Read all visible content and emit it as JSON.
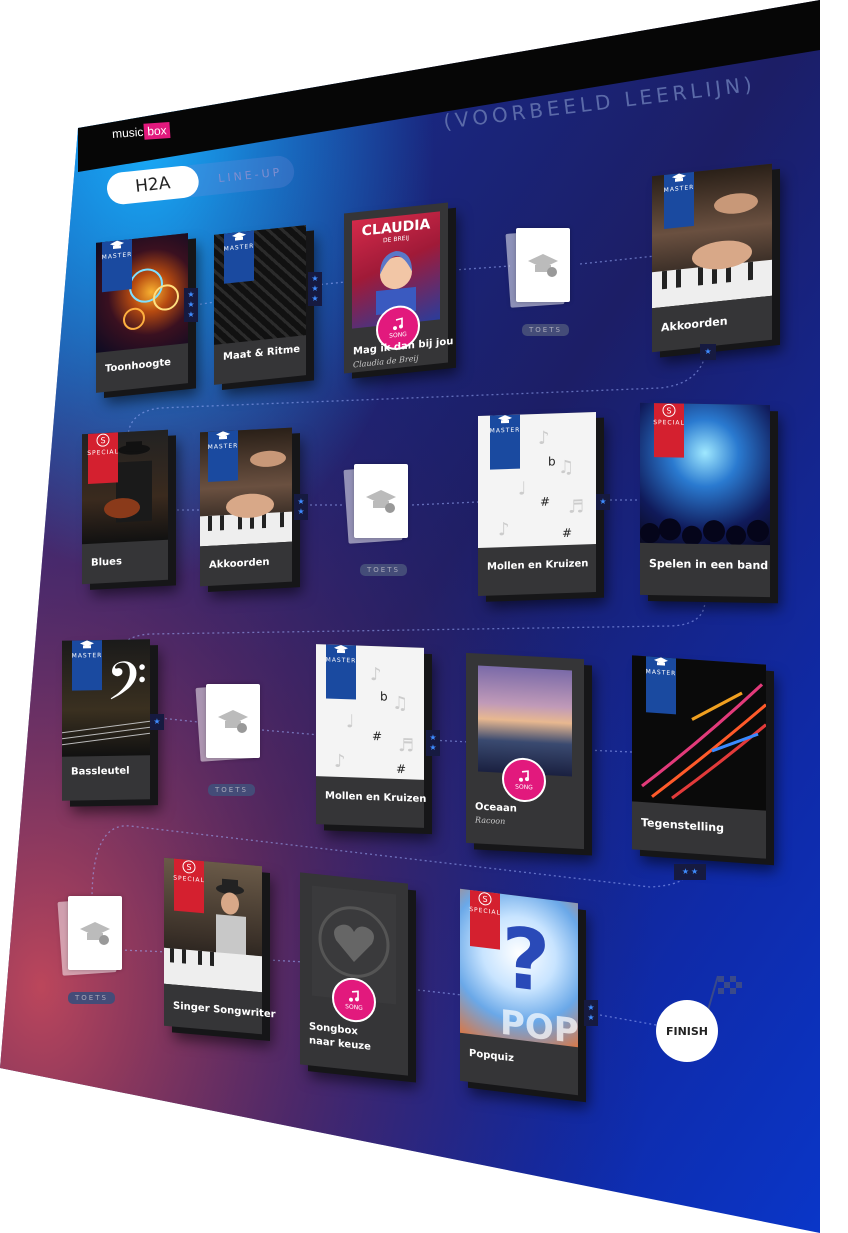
{
  "brand": {
    "name_part1": "music",
    "name_part2": "box"
  },
  "poster_title": "(VOORBEELD LEERLIJN)",
  "tabs": {
    "active": "H2A",
    "inactive": "LINE-UP"
  },
  "toets_label": "TOETS",
  "finish_label": "FINISH",
  "ribbons": {
    "master": "MASTER",
    "special": "SPECIAL"
  },
  "song_badge": "SONG",
  "colors": {
    "song_pink": "#e2197d",
    "master_blue": "#1a4aa0",
    "special_red": "#d4202f",
    "star_blue": "#3f8cff"
  },
  "rows": [
    {
      "cards": [
        {
          "title": "Toonhoogte",
          "ribbon": "master"
        },
        {
          "title": "Maat & Ritme",
          "ribbon": "master"
        },
        {
          "title": "Mag ik dan bij jou",
          "subtitle": "Claudia de Breij",
          "type": "song",
          "cover_line1": "CLAUDIA",
          "cover_line2": "DE BREIJ"
        },
        {
          "title": "TOETS",
          "type": "toets"
        },
        {
          "title": "Akkoorden",
          "ribbon": "master"
        }
      ]
    },
    {
      "cards": [
        {
          "title": "Blues",
          "ribbon": "special"
        },
        {
          "title": "Akkoorden",
          "ribbon": "master"
        },
        {
          "title": "TOETS",
          "type": "toets"
        },
        {
          "title": "Mollen en Kruizen",
          "ribbon": "master"
        },
        {
          "title": "Spelen in een band",
          "ribbon": "special"
        }
      ]
    },
    {
      "cards": [
        {
          "title": "Bassleutel",
          "ribbon": "master"
        },
        {
          "title": "TOETS",
          "type": "toets"
        },
        {
          "title": "Mollen en Kruizen",
          "ribbon": "master"
        },
        {
          "title": "Oceaan",
          "subtitle": "Racoon",
          "type": "song"
        },
        {
          "title": "Tegenstelling",
          "ribbon": "master"
        }
      ]
    },
    {
      "cards": [
        {
          "title": "TOETS",
          "type": "toets"
        },
        {
          "title": "Singer Songwriter",
          "ribbon": "special"
        },
        {
          "title": "Songbox naar keuze",
          "title_line1": "Songbox",
          "title_line2": "naar keuze",
          "type": "song"
        },
        {
          "title": "Popquiz",
          "ribbon": "special"
        }
      ]
    }
  ]
}
